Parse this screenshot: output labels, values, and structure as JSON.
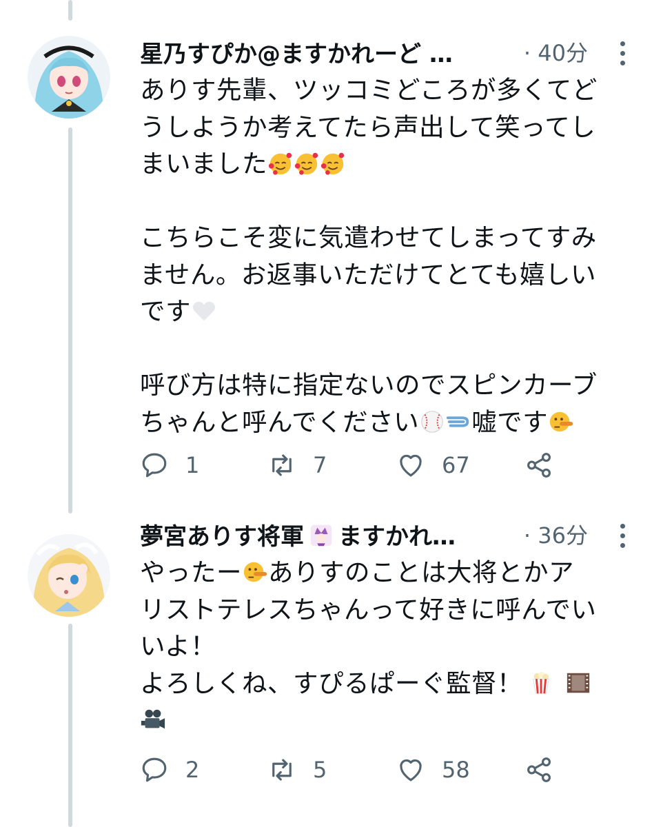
{
  "tweets": [
    {
      "author": "星乃すぴか@ますかれーど …",
      "time": "· 40分",
      "body_lines": [
        "ありす先輩、ツッコミどころが多くてど",
        "うしようか考えてたら声出して笑ってし",
        "まいました",
        "",
        "こちらこそ変に気遣わせてしまってすみ",
        "ません。お返事いただけてとても嬉しい",
        "です",
        "",
        "呼び方は特に指定ないのでスピンカーブ",
        "ちゃんと呼んでください",
        "嘘です"
      ],
      "replies": "1",
      "retweets": "7",
      "likes": "67"
    },
    {
      "author": "夢宮ありす将軍",
      "author_suffix": "ますかれ…",
      "time": "· 36分",
      "body_lines": [
        "やったー",
        "ありすのことは大将とかア",
        "リストテレスちゃんって好きに呼んでい",
        "いよ！",
        "よろしくね、すぴるぱーぐ監督！"
      ],
      "replies": "2",
      "retweets": "5",
      "likes": "58"
    }
  ],
  "icons": [
    "reply-icon",
    "retweet-icon",
    "like-icon",
    "share-icon",
    "more-icon"
  ],
  "colors": {
    "text": "#0f1419",
    "muted": "#536471",
    "thread_line": "#cfd9de"
  }
}
